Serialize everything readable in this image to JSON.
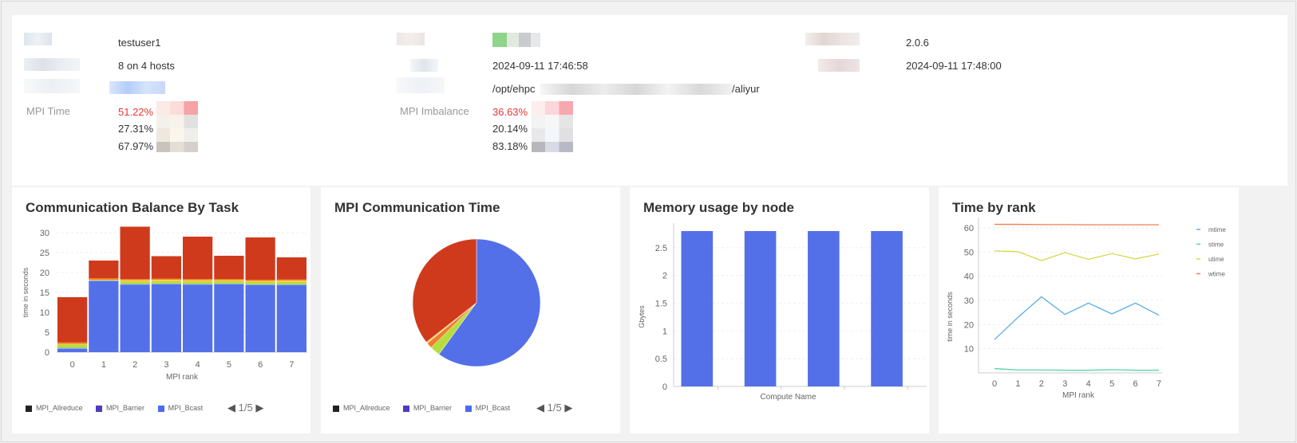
{
  "summary": {
    "user": "testuser1",
    "processes": "8 on 4 hosts",
    "version": "2.0.6",
    "start_time": "2024-09-11 17:46:58",
    "end_time": "2024-09-11 17:48:00",
    "command_prefix": "/opt/ehpc",
    "command_suffix": "/aliyur",
    "status_text": "已完成",
    "mpi_time_label": "MPI Time",
    "mpi_time_values": [
      "51.22%",
      "27.31%",
      "67.97%"
    ],
    "mpi_imbalance_label": "MPI Imbalance",
    "mpi_imbalance_values": [
      "36.63%",
      "20.14%",
      "83.18%"
    ]
  },
  "colors": {
    "red": "#e53935",
    "bar_blue": "#5470e8",
    "bar_red": "#cf3a1d",
    "bar_green": "#b6dd40",
    "bar_orange": "#f07c2e",
    "dark": "#1f1f1f",
    "purple": "#5b3fc4"
  },
  "panels": {
    "comm_balance": {
      "title": "Communication Balance By Task",
      "legend": [
        "MPI_Allreduce",
        "MPI_Barrier",
        "MPI_Bcast"
      ],
      "legend_colors": [
        "#222222",
        "#4b3cc2",
        "#4a6cf0"
      ],
      "pager": "1/5",
      "pager_prev": "◀",
      "pager_next": "▶"
    },
    "comm_time": {
      "title": "MPI Communication Time",
      "legend": [
        "MPI_Allreduce",
        "MPI_Barrier",
        "MPI_Bcast"
      ],
      "legend_colors": [
        "#222222",
        "#4b3cc2",
        "#4a6cf0"
      ],
      "pager": "1/5",
      "pager_prev": "◀",
      "pager_next": "▶"
    },
    "memory": {
      "title": "Memory usage by node"
    },
    "time_rank": {
      "title": "Time by rank"
    }
  },
  "chart_data": [
    {
      "type": "bar",
      "title": "Communication Balance By Task",
      "xlabel": "MPI rank",
      "ylabel": "time in seconds",
      "categories": [
        "0",
        "1",
        "2",
        "3",
        "4",
        "5",
        "6",
        "7"
      ],
      "ylim": [
        0,
        30
      ],
      "yticks": [
        0,
        5,
        10,
        15,
        20,
        25,
        30
      ],
      "stacked": true,
      "series": [
        {
          "color": "#5470e8",
          "values": [
            0.8,
            17.8,
            16.9,
            17.0,
            16.9,
            17.0,
            16.8,
            16.8
          ]
        },
        {
          "color": "#8fb0e8",
          "values": [
            0.3,
            0.2,
            0.2,
            0.2,
            0.2,
            0.2,
            0.2,
            0.2
          ]
        },
        {
          "color": "#b6dd40",
          "values": [
            0.8,
            0.1,
            0.6,
            0.6,
            0.6,
            0.6,
            0.6,
            0.6
          ]
        },
        {
          "color": "#f7d04a",
          "values": [
            0.2,
            0.1,
            0.4,
            0.4,
            0.4,
            0.3,
            0.3,
            0.4
          ]
        },
        {
          "color": "#f07c2e",
          "values": [
            0.4,
            0.4,
            0.3,
            0.3,
            0.3,
            0.3,
            0.3,
            0.3
          ]
        },
        {
          "color": "#cf3a1d",
          "values": [
            11.3,
            4.4,
            13.1,
            5.6,
            10.6,
            5.8,
            10.6,
            5.5
          ]
        }
      ]
    },
    {
      "type": "pie",
      "title": "MPI Communication Time",
      "slices": [
        {
          "color": "#5470e8",
          "value": 60.0
        },
        {
          "color": "#b6dd40",
          "value": 2.6
        },
        {
          "color": "#f07c2e",
          "value": 1.4
        },
        {
          "color": "#f7d04a",
          "value": 0.4
        },
        {
          "color": "#cf3a1d",
          "value": 35.6
        }
      ]
    },
    {
      "type": "bar",
      "title": "Memory usage by node",
      "xlabel": "Compute Name",
      "ylabel": "Gbytes",
      "categories": [
        "",
        "",
        "",
        ""
      ],
      "values": [
        2.8,
        2.8,
        2.8,
        2.8
      ],
      "ylim": [
        0,
        2.8
      ],
      "yticks": [
        0,
        0.5,
        1,
        1.5,
        2,
        2.5
      ]
    },
    {
      "type": "line",
      "title": "Time by rank",
      "xlabel": "MPI rank",
      "ylabel": "time in seconds",
      "x": [
        0,
        1,
        2,
        3,
        4,
        5,
        6,
        7
      ],
      "ylim": [
        0,
        63
      ],
      "yticks": [
        10,
        20,
        30,
        40,
        50,
        60
      ],
      "series": [
        {
          "name": "mtime",
          "color": "#5aaee8",
          "values": [
            13.8,
            23.0,
            31.5,
            24.2,
            28.9,
            24.4,
            28.9,
            23.9
          ]
        },
        {
          "name": "stime",
          "color": "#58d6a8",
          "values": [
            1.8,
            1.2,
            1.2,
            1.1,
            1.1,
            1.3,
            1.1,
            1.1
          ]
        },
        {
          "name": "utime",
          "color": "#d6d84a",
          "values": [
            50.5,
            50.2,
            46.5,
            49.8,
            47.0,
            49.4,
            47.2,
            49.2
          ]
        },
        {
          "name": "wtime",
          "color": "#f07c4e",
          "values": [
            61.5,
            61.5,
            61.4,
            61.4,
            61.3,
            61.3,
            61.3,
            61.3
          ]
        }
      ]
    }
  ]
}
